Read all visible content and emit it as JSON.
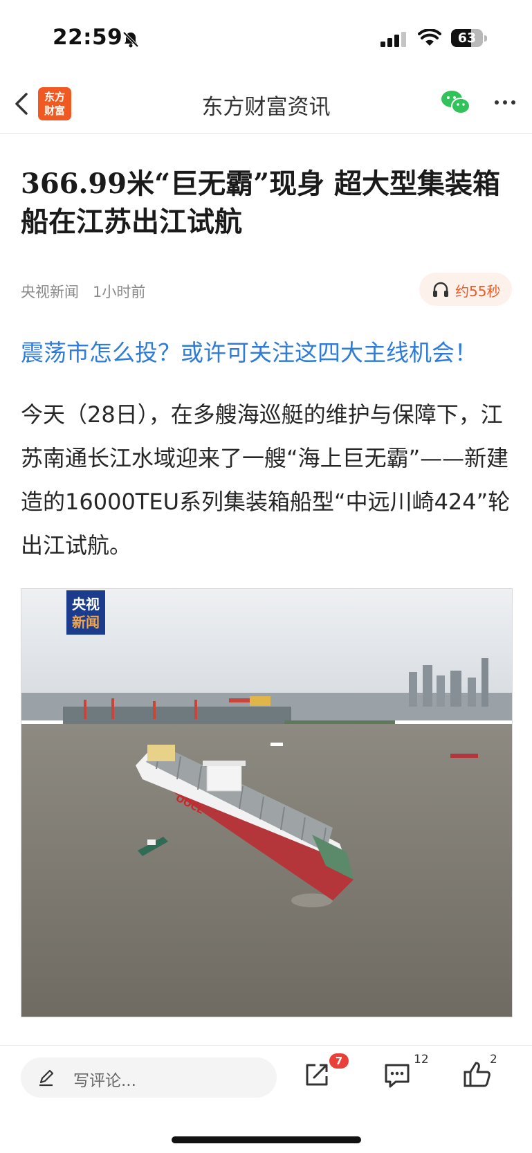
{
  "status_bar": {
    "time": "22:59",
    "battery": "63",
    "battery_level": 0.63
  },
  "nav": {
    "title": "东方财富资讯",
    "logo_text": "东方财富"
  },
  "article": {
    "title": "366.99米“巨无霸”现身 超大型集装箱船在江苏出江试航",
    "source": "央视新闻",
    "time_ago": "1小时前",
    "audio_duration": "约55秒",
    "promo_link": "震荡市怎么投？或许可关注这四大主线机会！",
    "paragraph": "今天（28日），在多艘海巡艇的维护与保障下，江苏南通长江水域迎来了一艘“海上巨无霸”——新建造的16000TEU系列集装箱船型“中远川崎424”轮出江试航。",
    "image_badge_line1": "央视",
    "image_badge_line2": "新闻",
    "ship_logo": "OOCL"
  },
  "bottom": {
    "comment_placeholder": "写评论...",
    "share_badge": "7",
    "comment_count": "12",
    "like_count": "2"
  },
  "icons": [
    "bell-muted-icon",
    "signal-icon",
    "wifi-icon",
    "back-arrow-icon",
    "wechat-icon",
    "more-icon",
    "headphones-icon",
    "pencil-icon",
    "share-icon",
    "comment-icon",
    "thumbs-up-icon"
  ],
  "colors": {
    "brand": "#f05a22",
    "link": "#2f7cd8",
    "badge": "#e9403a"
  }
}
